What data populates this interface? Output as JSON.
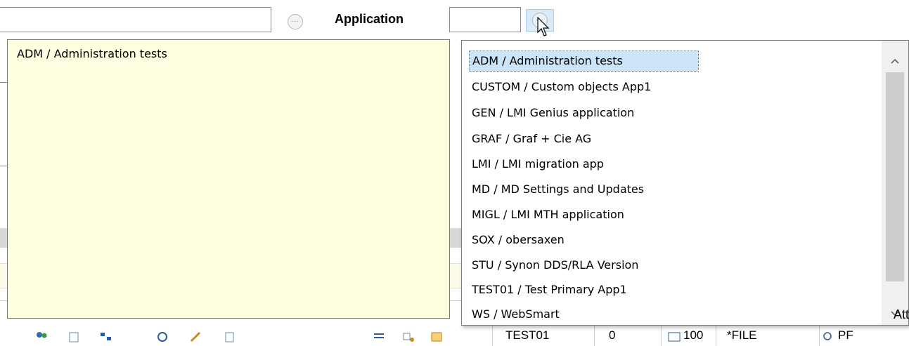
{
  "toolbar": {
    "application_label": "Application",
    "text_field_value": "",
    "application_field_value": "",
    "ellipsis_icon": "ellipsis-icon"
  },
  "tooltip": {
    "text": "ADM / Administration tests"
  },
  "dropdown": {
    "items": [
      "ADM / Administration tests",
      "CUSTOM / Custom objects App1",
      "GEN / LMI Genius application",
      "GRAF / Graf + Cie AG",
      "LMI / LMI migration app",
      "MD / MD Settings and Updates",
      "MIGL / LMI MTH application",
      "SOX / obersaxen",
      "STU / Synon DDS/RLA Version",
      "TEST01 / Test Primary App1",
      "WS / WebSmart"
    ],
    "selected_index": 0
  },
  "background": {
    "column_header_partial": "Att",
    "row": {
      "name": "TEST01",
      "count": "0",
      "size": "100",
      "type": "*FILE",
      "attr": "PF"
    }
  },
  "colors": {
    "tooltip_bg": "#ffffe1",
    "selection_bg": "#cce4f7",
    "scrollbar_bg": "#f0f0f0"
  }
}
